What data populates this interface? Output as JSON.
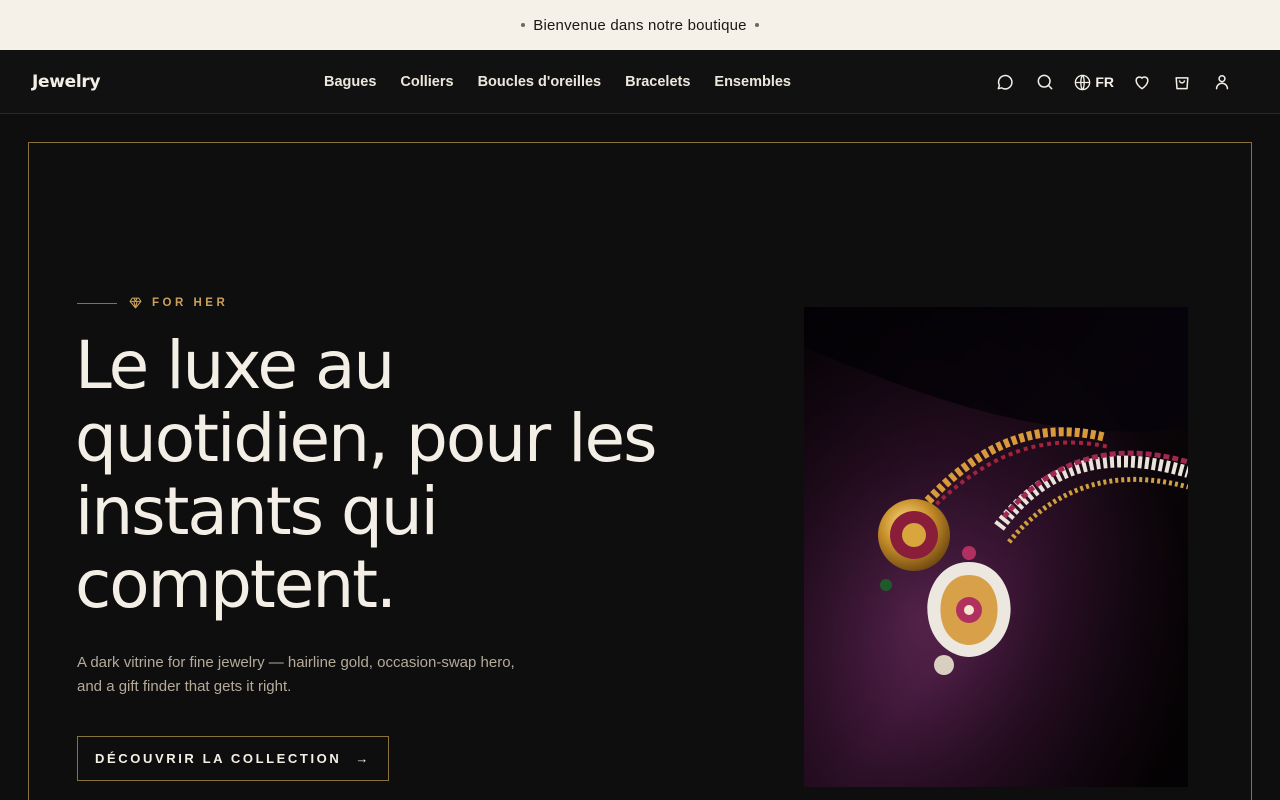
{
  "announcement": {
    "text": "Bienvenue dans notre boutique"
  },
  "nav": {
    "logo": "Jewelry",
    "menu": [
      {
        "label": "Bagues"
      },
      {
        "label": "Colliers"
      },
      {
        "label": "Boucles d'oreilles"
      },
      {
        "label": "Bracelets"
      },
      {
        "label": "Ensembles"
      }
    ],
    "language": "FR",
    "icons": [
      "chat-icon",
      "search-icon",
      "globe-icon",
      "heart-icon",
      "cart-icon",
      "user-icon"
    ]
  },
  "hero": {
    "eyebrow": "FOR HER",
    "headline": "Le luxe au quotidien, pour les instants qui comptent.",
    "lead": "A dark vitrine for fine jewelry — hairline gold, occasion-swap hero, and a gift finder that gets it right.",
    "cta": "DÉCOUVRIR LA COLLECTION",
    "cta_arrow": "→"
  },
  "colors": {
    "background": "#0f0e0e",
    "announcement_bg": "#f5f0e8",
    "gold": "#8a7240",
    "gold_text": "#c9a15a",
    "cream": "#f4efe6"
  }
}
